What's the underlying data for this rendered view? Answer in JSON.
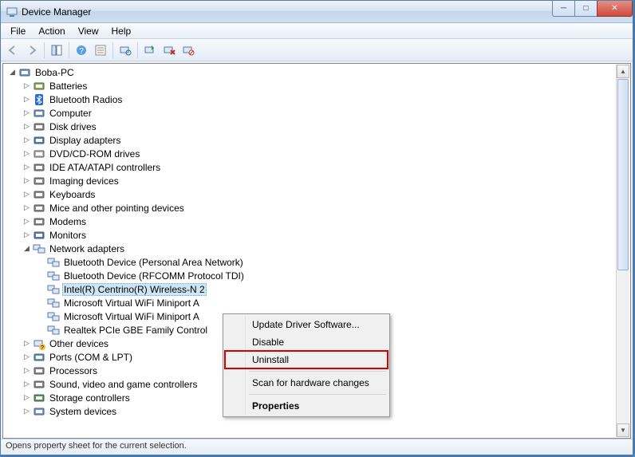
{
  "title": "Device Manager",
  "menu": {
    "file": "File",
    "action": "Action",
    "view": "View",
    "help": "Help"
  },
  "root": "Boba-PC",
  "categories": [
    {
      "label": "Batteries",
      "icon": "battery"
    },
    {
      "label": "Bluetooth Radios",
      "icon": "bluetooth"
    },
    {
      "label": "Computer",
      "icon": "computer"
    },
    {
      "label": "Disk drives",
      "icon": "disk"
    },
    {
      "label": "Display adapters",
      "icon": "display"
    },
    {
      "label": "DVD/CD-ROM drives",
      "icon": "cd"
    },
    {
      "label": "IDE ATA/ATAPI controllers",
      "icon": "ide"
    },
    {
      "label": "Imaging devices",
      "icon": "camera"
    },
    {
      "label": "Keyboards",
      "icon": "keyboard"
    },
    {
      "label": "Mice and other pointing devices",
      "icon": "mouse"
    },
    {
      "label": "Modems",
      "icon": "modem"
    },
    {
      "label": "Monitors",
      "icon": "monitor"
    }
  ],
  "networkCategory": "Network adapters",
  "adapters": [
    "Bluetooth Device (Personal Area Network)",
    "Bluetooth Device (RFCOMM Protocol TDI)",
    "Intel(R) Centrino(R) Wireless-N 2",
    "Microsoft Virtual WiFi Miniport A",
    "Microsoft Virtual WiFi Miniport A",
    "Realtek PCIe GBE Family Control"
  ],
  "categoriesAfter": [
    {
      "label": "Other devices",
      "icon": "other"
    },
    {
      "label": "Ports (COM & LPT)",
      "icon": "port"
    },
    {
      "label": "Processors",
      "icon": "cpu"
    },
    {
      "label": "Sound, video and game controllers",
      "icon": "sound"
    },
    {
      "label": "Storage controllers",
      "icon": "storage"
    },
    {
      "label": "System devices",
      "icon": "system"
    }
  ],
  "contextMenu": {
    "update": "Update Driver Software...",
    "disable": "Disable",
    "uninstall": "Uninstall",
    "scan": "Scan for hardware changes",
    "properties": "Properties"
  },
  "status": "Opens property sheet for the current selection."
}
